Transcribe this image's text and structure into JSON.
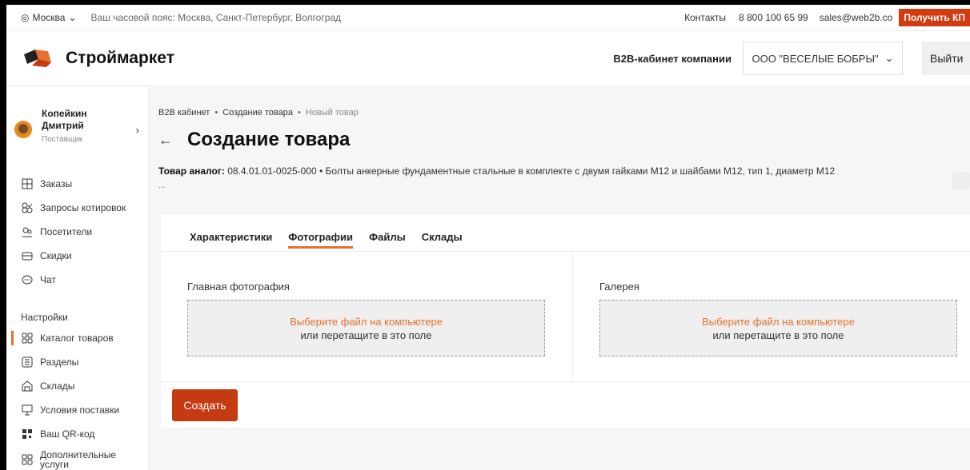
{
  "topbar": {
    "city": "Москва",
    "timezone": "Ваш часовой пояс: Москва, Санкт-Петербург, Волгоград",
    "contacts": "Контакты",
    "phone": "8 800 100 65 99",
    "email": "sales@web2b.co",
    "get_kp": "Получить КП"
  },
  "header": {
    "logo_text": "Строймаркет",
    "b2b_label": "B2B-кабинет компании",
    "company": "ООО \"ВЕСЕЛЫЕ БОБРЫ\"",
    "logout": "Выйти"
  },
  "user": {
    "surname": "Копейкин",
    "name": "Дмитрий",
    "role": "Поставщик"
  },
  "menu": {
    "main": [
      {
        "label": "Заказы",
        "icon": "orders-icon"
      },
      {
        "label": "Запросы котировок",
        "icon": "quotes-icon"
      },
      {
        "label": "Посетители",
        "icon": "visitors-icon"
      },
      {
        "label": "Скидки",
        "icon": "discounts-icon"
      },
      {
        "label": "Чат",
        "icon": "chat-icon"
      }
    ],
    "settings_title": "Настройки",
    "settings": [
      {
        "label": "Каталог товаров",
        "icon": "catalog-icon"
      },
      {
        "label": "Разделы",
        "icon": "sections-icon"
      },
      {
        "label": "Склады",
        "icon": "warehouse-icon"
      },
      {
        "label": "Условия поставки",
        "icon": "delivery-icon"
      },
      {
        "label": "Ваш QR-код",
        "icon": "qr-icon"
      },
      {
        "label": "Дополнительные услуги",
        "icon": "services-icon"
      }
    ]
  },
  "breadcrumbs": [
    "B2B кабинет",
    "Создание товара",
    "Новый товар"
  ],
  "page_title": "Создание товара",
  "analog": {
    "label": "Товар аналог:",
    "code": "08.4.01.01-0025-000",
    "description": "Болты анкерные фундаментные стальные в комплекте с двумя гайками М12 и шайбами М12, тип 1, диаметр М12",
    "more": "..."
  },
  "tabs": [
    "Характеристики",
    "Фотографии",
    "Файлы",
    "Склады"
  ],
  "active_tab": "Фотографии",
  "upload": {
    "main_label": "Главная фотография",
    "gallery_label": "Галерея",
    "pick": "Выберите файл на компьютере",
    "drag": "или перетащите в это поле"
  },
  "create_button": "Создать",
  "colors": {
    "accent": "#e8702a",
    "brand_red": "#c53a10"
  }
}
